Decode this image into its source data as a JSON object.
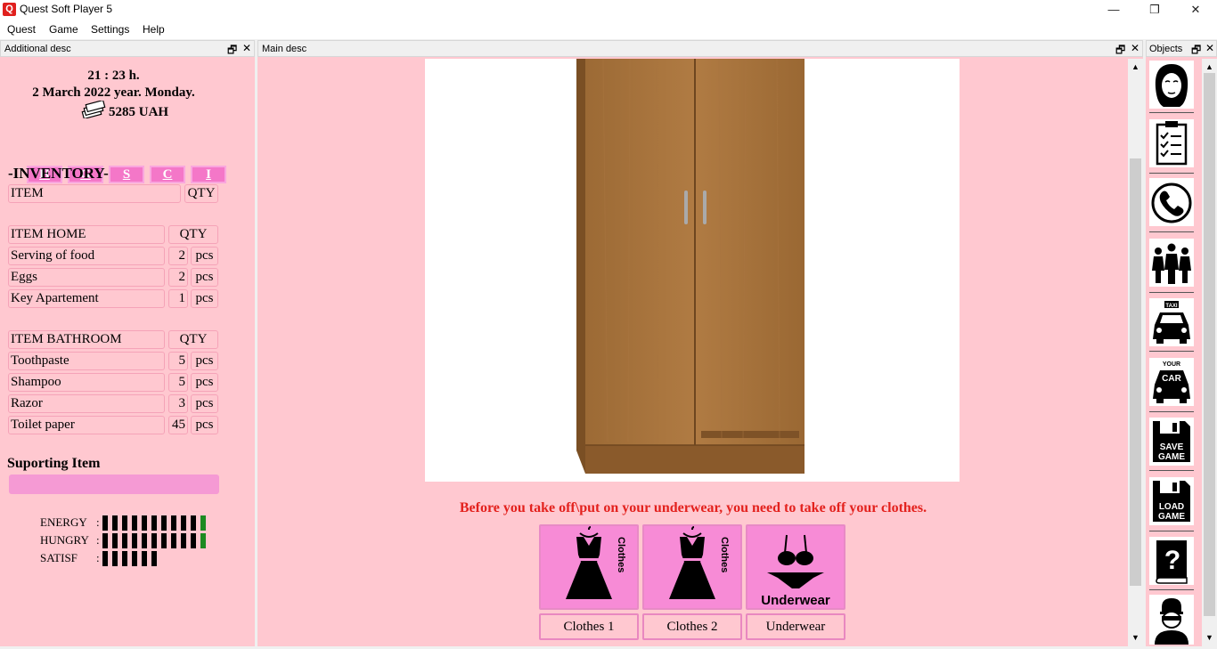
{
  "window": {
    "title": "Quest Soft Player 5",
    "icon_letter": "Q",
    "minimize": "—",
    "maximize": "❐",
    "close": "✕"
  },
  "menu": [
    "Quest",
    "Game",
    "Settings",
    "Help"
  ],
  "panels": {
    "additional": {
      "title": "Additional desc",
      "restore": "🗗",
      "close": "✕"
    },
    "main": {
      "title": "Main desc",
      "restore": "🗗",
      "close": "✕"
    },
    "objects": {
      "title": "Objects",
      "restore": "🗗",
      "close": "✕"
    }
  },
  "status": {
    "time": "21 : 23 h.",
    "date": "2 March 2022 year. Monday.",
    "money": "5285 UAH"
  },
  "nav_buttons": [
    "H",
    "G",
    "S",
    "C",
    "I"
  ],
  "inventory": {
    "title": "-INVENTORY-",
    "header": {
      "item": "ITEM",
      "qty": "QTY"
    }
  },
  "home": {
    "header": {
      "item": "ITEM HOME",
      "qty": "QTY"
    },
    "rows": [
      {
        "name": "Serving of food",
        "qty": "2",
        "unit": "pcs"
      },
      {
        "name": "Eggs",
        "qty": "2",
        "unit": "pcs"
      },
      {
        "name": "Key Apartement",
        "qty": "1",
        "unit": "pcs"
      }
    ]
  },
  "bathroom": {
    "header": {
      "item": "ITEM BATHROOM",
      "qty": "QTY"
    },
    "rows": [
      {
        "name": "Toothpaste",
        "qty": "5",
        "unit": "pcs"
      },
      {
        "name": "Shampoo",
        "qty": "5",
        "unit": "pcs"
      },
      {
        "name": "Razor",
        "qty": "3",
        "unit": "pcs"
      },
      {
        "name": "Toilet paper",
        "qty": "45",
        "unit": "pcs"
      }
    ]
  },
  "supporting": {
    "title": "Suporting Item"
  },
  "stats": [
    {
      "label": "ENERGY",
      "sep": ":",
      "level": 11,
      "max": 11,
      "green_tail": true
    },
    {
      "label": "HUNGRY",
      "sep": ":",
      "level": 11,
      "max": 11,
      "green_tail": true
    },
    {
      "label": "SATISF",
      "sep": ":",
      "level": 6,
      "max": 11,
      "green_tail": false
    }
  ],
  "main": {
    "warning": "Before you take off\\put on your underwear, you need to take off your clothes.",
    "warning_color": "#e3211d",
    "clothes_text": "Clothes",
    "underwear_text": "Underwear",
    "actions": [
      {
        "label": "Clothes 1",
        "icon": "dress-icon"
      },
      {
        "label": "Clothes 2",
        "icon": "dress-icon"
      },
      {
        "label": "Underwear",
        "icon": "lingerie-icon"
      }
    ]
  },
  "objects": {
    "icons": [
      "woman-portrait-icon",
      "clipboard-checklist-icon",
      "phone-icon",
      "people-group-icon",
      "taxi-icon",
      "your-car-icon",
      "save-game-icon",
      "load-game-icon",
      "help-book-icon",
      "burglar-icon"
    ],
    "taxi_text": "TAXI",
    "your_text": "YOUR",
    "car_text": "CAR",
    "save_text": "SAVE",
    "load_text": "LOAD",
    "game_text": "GAME"
  },
  "colors": {
    "panel_bg": "#ffc8d0",
    "button_pink": "#f477c8",
    "bar_green": "#1c8a21"
  }
}
